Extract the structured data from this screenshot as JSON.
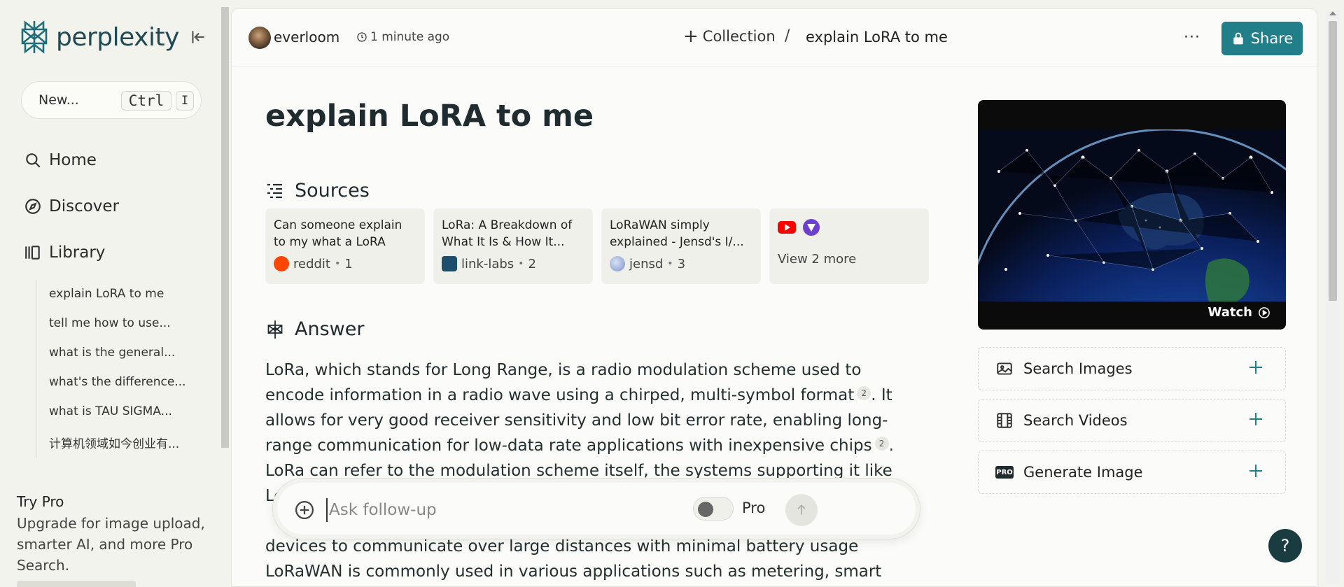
{
  "app": {
    "name": "perplexity"
  },
  "sidebar": {
    "new_label": "New...",
    "shortcut_ctrl": "Ctrl",
    "shortcut_key": "I",
    "nav": [
      {
        "label": "Home",
        "icon": "search-icon"
      },
      {
        "label": "Discover",
        "icon": "compass-icon"
      },
      {
        "label": "Library",
        "icon": "library-icon"
      }
    ],
    "library_items": [
      "explain LoRA to me",
      "tell me how to use...",
      "what is the general...",
      "what's the difference...",
      "what is TAU SIGMA...",
      "计算机领域如今创业有..."
    ],
    "try_pro_title": "Try Pro",
    "try_pro_desc": "Upgrade for image upload, smarter AI, and more Pro Search."
  },
  "topbar": {
    "user": "everloom",
    "time": "1 minute ago",
    "collection_label": "Collection",
    "separator": "/",
    "crumb_title": "explain LoRA to me",
    "more": "···",
    "share_label": "Share"
  },
  "thread": {
    "title": "explain LoRA to me",
    "sources_heading": "Sources",
    "sources": [
      {
        "title": "Can someone explain to my what a LoRA is?...",
        "site": "reddit",
        "index": "1",
        "favicon": "reddit-icon"
      },
      {
        "title": "LoRa: A Breakdown of What It Is & How It...",
        "site": "link-labs",
        "index": "2",
        "favicon": "link-labs-icon"
      },
      {
        "title": "LoRaWAN simply explained - Jensd's I/...",
        "site": "jensd",
        "index": "3",
        "favicon": "jensd-icon"
      }
    ],
    "view_more": "View 2 more",
    "answer_heading": "Answer",
    "answer": {
      "p1": "LoRa, which stands for Long Range, is a radio modulation scheme used to encode information in a radio wave using a chirped, multi-symbol format",
      "cite_a": "2",
      "p2": ". It allows for very good receiver sensitivity and low bit error rate, enabling long-range communication for low-data rate applications with inexpensive chips",
      "cite_b": "2",
      "p3": ". LoRa can refer to the modulation scheme itself, the systems supporting it like LoRa chips and gateways,",
      "p4": "devices to communicate over large distances with minimal battery usage",
      "p5": "LoRaWAN is commonly used in various applications such as metering, smart"
    }
  },
  "ask": {
    "placeholder": "Ask follow-up",
    "pro_label": "Pro",
    "pro_enabled": false
  },
  "right": {
    "watch_label": "Watch",
    "tools": [
      {
        "label": "Search Images",
        "icon": "image-icon"
      },
      {
        "label": "Search Videos",
        "icon": "film-icon"
      },
      {
        "label": "Generate Image",
        "icon": "pro-badge-icon"
      }
    ],
    "pro_badge": "PRO"
  },
  "help_label": "?",
  "colors": {
    "accent": "#217f8a",
    "background": "#f3f3ee",
    "panel": "#fbfbf9",
    "dark": "#1f2b2e"
  }
}
